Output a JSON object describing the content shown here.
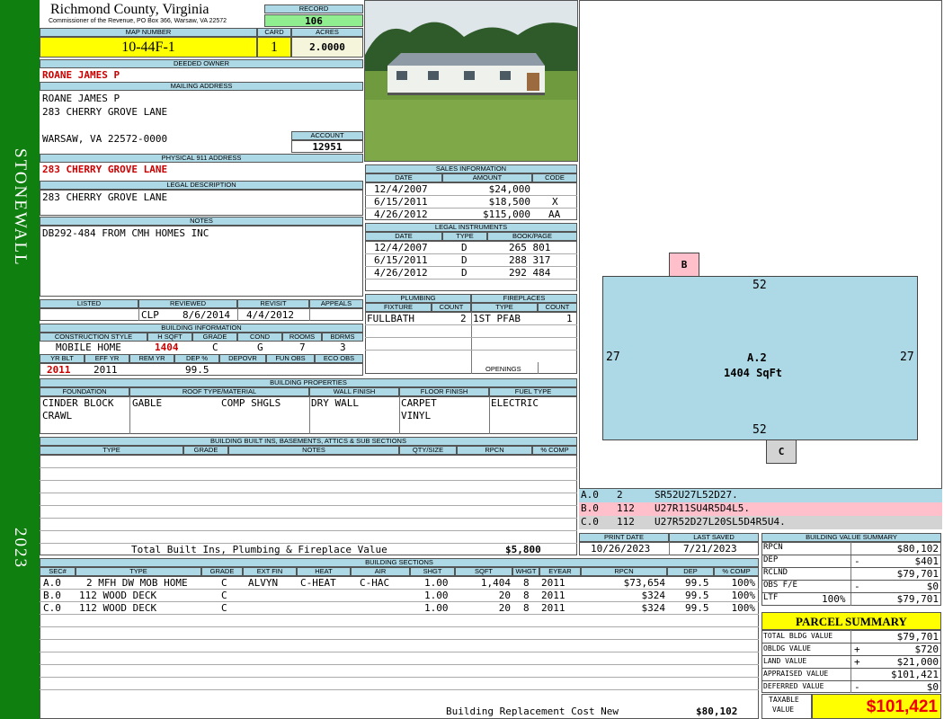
{
  "sidebar": {
    "district": "STONEWALL",
    "year": "2023"
  },
  "header": {
    "county": "Richmond County, Virginia",
    "subtitle": "Commissioner of the Revenue, PO Box 366, Warsaw, VA 22572"
  },
  "record": {
    "label": "RECORD",
    "value": "106"
  },
  "map": {
    "label": "MAP NUMBER",
    "value": "10-44F-1",
    "card_label": "CARD",
    "card": "1",
    "acres_label": "ACRES",
    "acres": "2.0000"
  },
  "owner": {
    "label": "DEEDED OWNER",
    "value": "ROANE JAMES P"
  },
  "mailing": {
    "label": "MAILING ADDRESS",
    "line1": "ROANE JAMES P",
    "line2": "283 CHERRY GROVE LANE",
    "line3": "WARSAW, VA 22572-0000"
  },
  "account": {
    "label": "ACCOUNT",
    "value": "12951"
  },
  "physical": {
    "label": "PHYSICAL 911 ADDRESS",
    "value": "283 CHERRY GROVE LANE"
  },
  "legal": {
    "label": "LEGAL DESCRIPTION",
    "value": "283 CHERRY GROVE LANE"
  },
  "notes": {
    "label": "NOTES",
    "value": "DB292-484 FROM CMH HOMES INC"
  },
  "review": {
    "listed_label": "LISTED",
    "reviewed_label": "REVIEWED",
    "revisit_label": "REVISIT",
    "appeals_label": "APPEALS",
    "listed": "",
    "reviewer": "CLP",
    "reviewed": "8/6/2014",
    "revisit": "4/4/2012",
    "appeals": ""
  },
  "building_info": {
    "label": "BUILDING INFORMATION",
    "cols": [
      "CONSTRUCTION STYLE",
      "H SQFT",
      "GRADE",
      "COND",
      "ROOMS",
      "BDRMS"
    ],
    "style": "MOBILE HOME",
    "hsqft": "1404",
    "grade": "C",
    "cond": "G",
    "rooms": "7",
    "bdrms": "3",
    "cols2": [
      "YR BLT",
      "EFF YR",
      "REM YR",
      "DEP %",
      "DEPOVR",
      "FUN OBS",
      "ECO OBS"
    ],
    "yrblt": "2011",
    "effyr": "2011",
    "remyr": "",
    "dep": "99.5",
    "depovr": "",
    "funobs": "",
    "ecoobs": ""
  },
  "sales": {
    "label": "SALES INFORMATION",
    "cols": [
      "DATE",
      "AMOUNT",
      "CODE"
    ],
    "rows": [
      [
        "12/4/2007",
        "$24,000",
        ""
      ],
      [
        "6/15/2011",
        "$18,500",
        "X"
      ],
      [
        "4/26/2012",
        "$115,000",
        "AA"
      ]
    ]
  },
  "instruments": {
    "label": "LEGAL INSTRUMENTS",
    "cols": [
      "DATE",
      "TYPE",
      "BOOK/PAGE"
    ],
    "rows": [
      [
        "12/4/2007",
        "D",
        "265 801"
      ],
      [
        "6/15/2011",
        "D",
        "288 317"
      ],
      [
        "4/26/2012",
        "D",
        "292 484"
      ]
    ]
  },
  "plumbing": {
    "label": "PLUMBING",
    "cols": [
      "FIXTURE",
      "COUNT"
    ],
    "fixture": "FULLBATH",
    "count": "2"
  },
  "fireplaces": {
    "label": "FIREPLACES",
    "cols": [
      "TYPE",
      "COUNT"
    ],
    "type": "1ST PFAB",
    "count": "1",
    "openings_label": "OPENINGS"
  },
  "properties": {
    "label": "BUILDING PROPERTIES",
    "cols": [
      "FOUNDATION",
      "ROOF TYPE/MATERIAL",
      "WALL FINISH",
      "FLOOR FINISH",
      "FUEL TYPE"
    ],
    "foundation1": "CINDER BLOCK",
    "foundation2": "CRAWL",
    "roof1": "GABLE",
    "roof2": "COMP SHGLS",
    "wall": "DRY WALL",
    "floor1": "CARPET",
    "floor2": "VINYL",
    "fuel": "ELECTRIC"
  },
  "builtins": {
    "label": "BUILDING BUILT INS, BASEMENTS, ATTICS & SUB SECTIONS",
    "cols": [
      "TYPE",
      "GRADE",
      "NOTES",
      "QTY/SIZE",
      "RPCN",
      "% COMP"
    ],
    "total_label": "Total Built Ins, Plumbing & Fireplace Value",
    "total": "$5,800"
  },
  "sections": {
    "label": "BUILDING SECTIONS",
    "cols": [
      "SEC#",
      "TYPE",
      "GRADE",
      "EXT FIN",
      "HEAT",
      "AIR",
      "SHGT",
      "SQFT",
      "WHGT",
      "EYEAR",
      "RPCN",
      "DEP",
      "% COMP"
    ],
    "rows": [
      [
        "A.0",
        "2 MFH DW MOB HOME",
        "C",
        "ALVYN",
        "C-HEAT",
        "C-HAC",
        "1.00",
        "1,404",
        "8",
        "2011",
        "$73,654",
        "99.5",
        "100%"
      ],
      [
        "B.0",
        "112 WOOD DECK",
        "C",
        "",
        "",
        "",
        "1.00",
        "20",
        "8",
        "2011",
        "$324",
        "99.5",
        "100%"
      ],
      [
        "C.0",
        "112 WOOD DECK",
        "C",
        "",
        "",
        "",
        "1.00",
        "20",
        "8",
        "2011",
        "$324",
        "99.5",
        "100%"
      ]
    ],
    "replacement_label": "Building Replacement Cost New",
    "replacement": "$80,102"
  },
  "sketch": {
    "main_label": "A.2",
    "main_sqft": "1404 SqFt",
    "top": "52",
    "bottom": "52",
    "left": "27",
    "right": "27",
    "deck_b": "B",
    "deck_c": "C"
  },
  "legend": [
    {
      "id": "A.0",
      "code": "2",
      "path": "SR52U27L52D27.",
      "color": "#add8e6"
    },
    {
      "id": "B.0",
      "code": "112",
      "path": "U27R11SU4R5D4L5.",
      "color": "#ffc0cb"
    },
    {
      "id": "C.0",
      "code": "112",
      "path": "U27R52D27L20SL5D4R5U4.",
      "color": "#d3d3d3"
    }
  ],
  "dates": {
    "print_label": "PRINT DATE",
    "print": "10/26/2023",
    "saved_label": "LAST SAVED",
    "saved": "7/21/2023"
  },
  "value_summary": {
    "label": "BUILDING VALUE SUMMARY",
    "rows": [
      [
        "RPCN",
        "",
        "$80,102"
      ],
      [
        "DEP",
        "-",
        "$401"
      ],
      [
        "RCLND",
        "",
        "$79,701"
      ],
      [
        "OBS F/E",
        "-",
        "$0"
      ],
      [
        "LTF",
        "100%",
        "$79,701"
      ]
    ]
  },
  "parcel": {
    "label": "PARCEL SUMMARY",
    "rows": [
      [
        "TOTAL BLDG VALUE",
        "",
        "$79,701"
      ],
      [
        "OBLDG VALUE",
        "+",
        "$720"
      ],
      [
        "LAND VALUE",
        "+",
        "$21,000"
      ],
      [
        "APPRAISED VALUE",
        "",
        "$101,421"
      ],
      [
        "DEFERRED VALUE",
        "-",
        "$0"
      ]
    ],
    "taxable_label1": "TAXABLE",
    "taxable_label2": "VALUE",
    "taxable": "$101,421"
  }
}
